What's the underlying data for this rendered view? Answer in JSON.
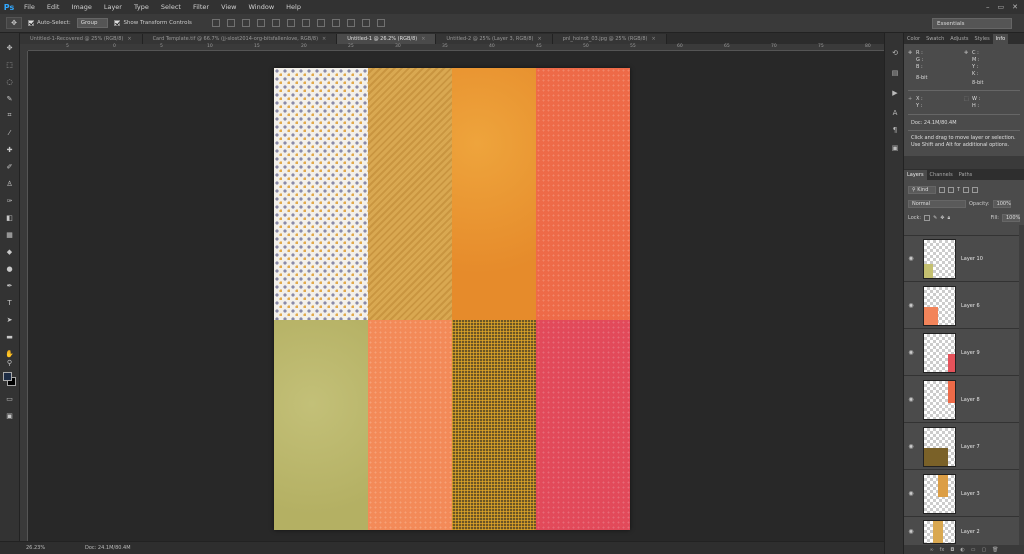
{
  "app": {
    "logo": "Ps"
  },
  "menu": [
    "File",
    "Edit",
    "Image",
    "Layer",
    "Type",
    "Select",
    "Filter",
    "View",
    "Window",
    "Help"
  ],
  "window_controls": [
    "–",
    "▭",
    "✕"
  ],
  "options": {
    "auto_select_label": "Auto-Select:",
    "auto_select_value": "Group",
    "transform_label": "Show Transform Controls",
    "workspace": "Essentials"
  },
  "tabs": [
    {
      "label": "Untitled-1-Recovered @ 25% (RGB/8)",
      "active": false
    },
    {
      "label": "Card Template.tif @ 66.7% (jj-slost2014-org-bitsfallenlove, RGB/8)",
      "active": false
    },
    {
      "label": "Untitled-1 @ 26.2% (RGB/8)",
      "active": true
    },
    {
      "label": "Untitled-2 @ 25% (Layer 3, RGB/8)",
      "active": false
    },
    {
      "label": "pnl_hoindt_03.jpg @ 25% (RGB/8)",
      "active": false
    }
  ],
  "ruler_top": [
    "5",
    "0",
    "5",
    "10",
    "15",
    "20",
    "25",
    "30",
    "35",
    "40",
    "45",
    "50",
    "55",
    "60",
    "65",
    "70",
    "75",
    "80"
  ],
  "status": {
    "zoom": "26.23%",
    "doc": "Doc: 24.1M/80.4M"
  },
  "panel_tabs": [
    "Color",
    "Swatch",
    "Adjusts",
    "Styles",
    "Info"
  ],
  "info": {
    "r": "R :",
    "g": "G :",
    "b": "B :",
    "c": "C :",
    "m": "M :",
    "y": "Y :",
    "k": "K :",
    "bit_left": "8-bit",
    "bit_right": "8-bit",
    "x": "X :",
    "y2": "Y :",
    "w": "W :",
    "h": "H :",
    "doc": "Doc: 24.1M/80.4M",
    "message": "Click and drag to move layer or selection. Use Shift and Alt for additional options."
  },
  "layers_tabs": [
    "Layers",
    "Channels",
    "Paths"
  ],
  "layers_controls": {
    "kind": "Kind",
    "blend": "Normal",
    "opacity_label": "Opacity:",
    "opacity": "100%",
    "lock_label": "Lock:",
    "fill_label": "Fill:",
    "fill": "100%"
  },
  "layers": [
    {
      "name": "Layer 10",
      "thumb_color": "#c4c070"
    },
    {
      "name": "Layer 6",
      "thumb_color": "#f2845a"
    },
    {
      "name": "Layer 9",
      "thumb_color": "#e5525a"
    },
    {
      "name": "Layer 8",
      "thumb_color": "#ee6a48"
    },
    {
      "name": "Layer 7",
      "thumb_color": "#7a6128"
    },
    {
      "name": "Layer 3",
      "thumb_color": "#dc9e45"
    },
    {
      "name": "Layer 2",
      "thumb_color": "#d9a851"
    }
  ],
  "colors": {
    "foreground": "#1e2d45",
    "background": "#000000"
  }
}
